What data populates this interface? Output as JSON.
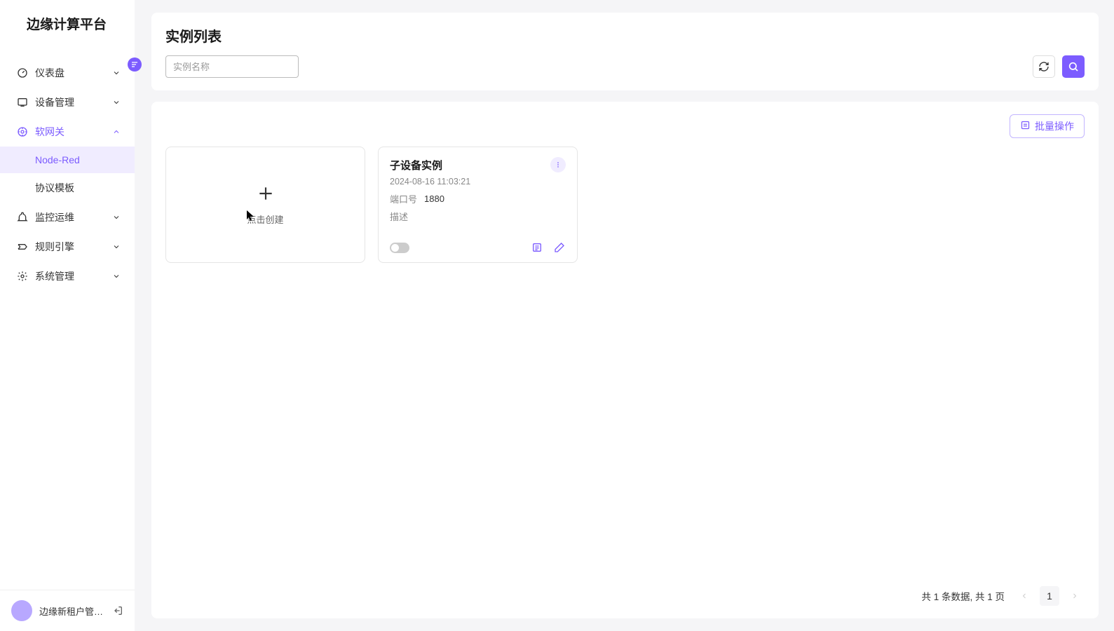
{
  "app_title": "边缘计算平台",
  "sidebar": {
    "items": [
      {
        "label": "仪表盘",
        "icon": "gauge",
        "expanded": false
      },
      {
        "label": "设备管理",
        "icon": "device",
        "expanded": false
      },
      {
        "label": "软网关",
        "icon": "gateway",
        "expanded": true,
        "active": true,
        "children": [
          {
            "label": "Node-Red",
            "active": true
          },
          {
            "label": "协议模板",
            "active": false
          }
        ]
      },
      {
        "label": "监控运维",
        "icon": "monitor",
        "expanded": false
      },
      {
        "label": "规则引擎",
        "icon": "rules",
        "expanded": false
      },
      {
        "label": "系统管理",
        "icon": "settings",
        "expanded": false
      }
    ],
    "user": "边缘新租户管…"
  },
  "page": {
    "title": "实例列表",
    "search_placeholder": "实例名称",
    "batch_label": "批量操作",
    "create_label": "点击创建"
  },
  "instances": [
    {
      "name": "子设备实例",
      "timestamp": "2024-08-16 11:03:21",
      "port_label": "端口号",
      "port_value": "1880",
      "desc_label": "描述",
      "desc_value": "",
      "enabled": false
    }
  ],
  "pagination": {
    "summary": "共 1 条数据, 共 1 页",
    "current": "1"
  },
  "colors": {
    "accent": "#7c5cff"
  }
}
